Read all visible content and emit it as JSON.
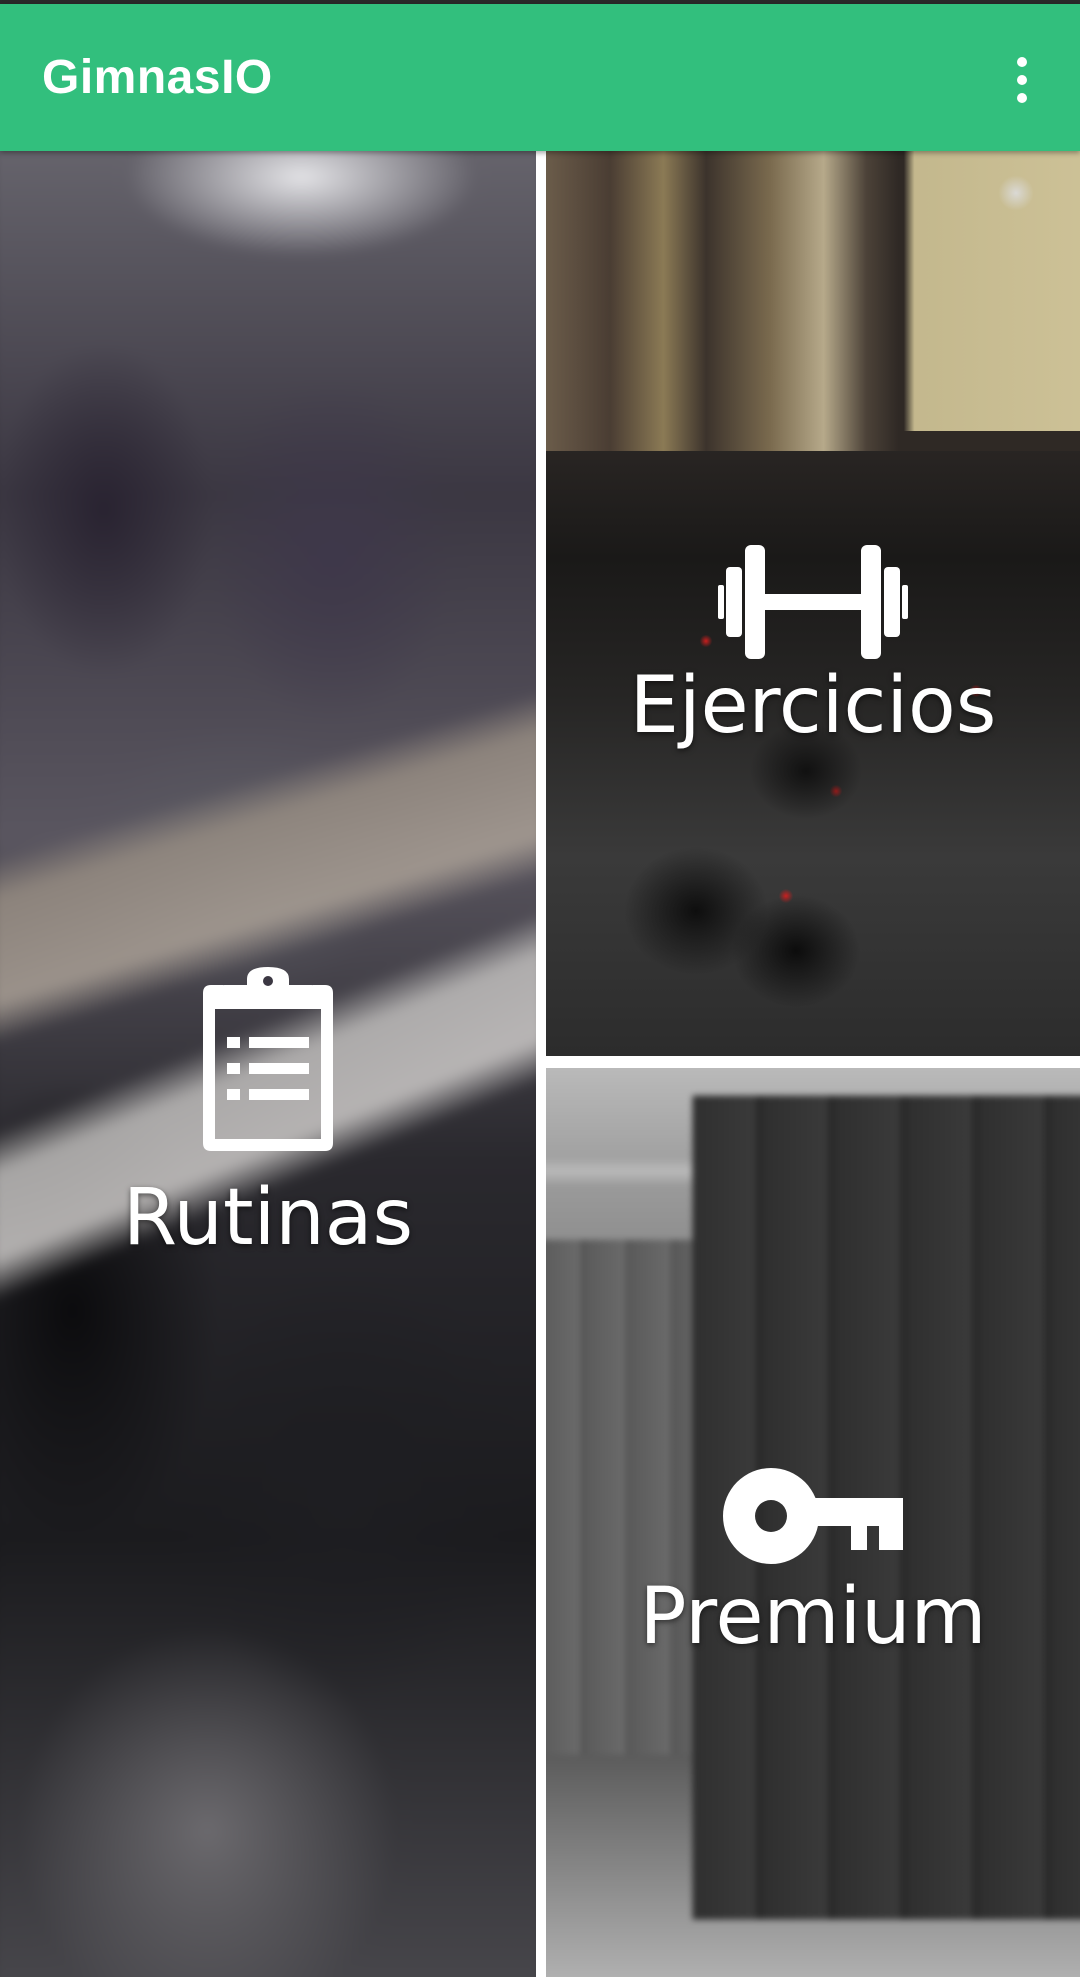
{
  "app_bar": {
    "title": "GimnasIO",
    "background_color": "#32bf7d",
    "menu_icon": "more-vert-icon"
  },
  "tiles": {
    "rutinas": {
      "label": "Rutinas",
      "icon": "clipboard-list-icon"
    },
    "ejercicios": {
      "label": "Ejercicios",
      "icon": "dumbbell-icon"
    },
    "premium": {
      "label": "Premium",
      "icon": "key-icon"
    }
  }
}
